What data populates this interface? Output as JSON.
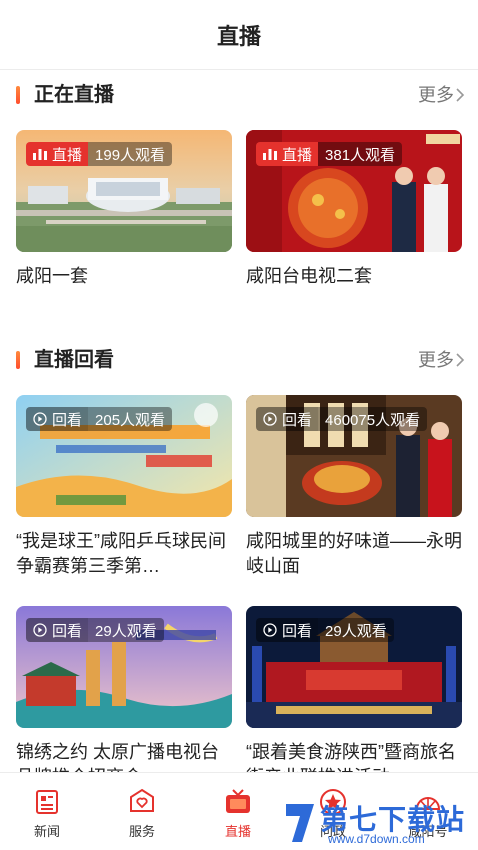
{
  "header": {
    "title": "直播"
  },
  "live_section": {
    "title": "正在直播",
    "more": "更多",
    "cards": [
      {
        "badge": "直播",
        "viewers": "199人观看",
        "caption": "咸阳一套"
      },
      {
        "badge": "直播",
        "viewers": "381人观看",
        "caption": "咸阳台电视二套"
      }
    ]
  },
  "replay_section": {
    "title": "直播回看",
    "more": "更多",
    "cards": [
      {
        "badge": "回看",
        "viewers": "205人观看",
        "caption": "“我是球王”咸阳乒乓球民间争霸赛第三季第…"
      },
      {
        "badge": "回看",
        "viewers": "460075人观看",
        "caption": "咸阳城里的好味道——永明岐山面"
      },
      {
        "badge": "回看",
        "viewers": "29人观看",
        "caption": "锦绣之约 太原广播电视台品牌推介招商会"
      },
      {
        "badge": "回看",
        "viewers": "29人观看",
        "caption": "“跟着美食游陕西”暨商旅名街产业联推进活动"
      }
    ]
  },
  "tabbar": {
    "items": [
      {
        "label": "新闻",
        "icon": "news-icon"
      },
      {
        "label": "服务",
        "icon": "service-icon"
      },
      {
        "label": "直播",
        "icon": "tv-icon"
      },
      {
        "label": "问政",
        "icon": "star-icon"
      },
      {
        "label": "咸阳号",
        "icon": "fan-icon"
      }
    ]
  },
  "watermark": {
    "main": "第七下载站",
    "sub": "www.d7down.com"
  },
  "colors": {
    "accent": "#e5322d",
    "section_bar": "#ff6a2e",
    "watermark": "#2d6ad8"
  }
}
